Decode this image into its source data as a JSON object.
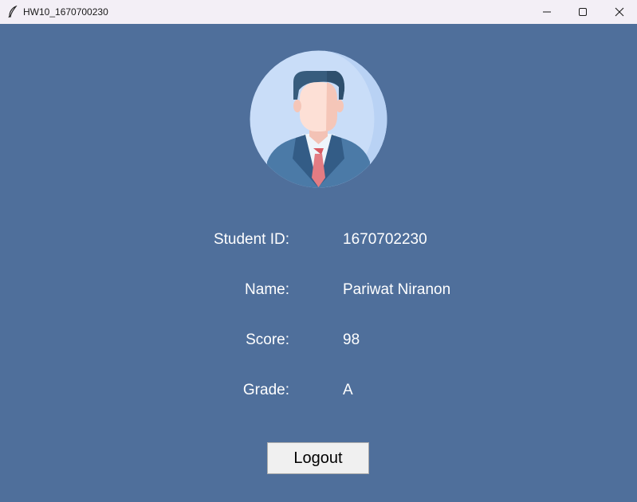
{
  "window": {
    "title": "HW10_1670700230"
  },
  "colors": {
    "background": "#4f6f9b",
    "titlebar": "#f3eff6",
    "text": "#ffffff",
    "button_bg": "#f0f0f0"
  },
  "icons": {
    "app": "feather-icon",
    "avatar": "businessman-avatar-icon",
    "minimize": "minimize-icon",
    "maximize": "maximize-icon",
    "close": "close-icon"
  },
  "student": {
    "id_label": "Student ID:",
    "id_value": "1670702230",
    "name_label": "Name:",
    "name_value": "Pariwat Niranon",
    "score_label": "Score:",
    "score_value": "98",
    "grade_label": "Grade:",
    "grade_value": "A"
  },
  "actions": {
    "logout_label": "Logout"
  }
}
